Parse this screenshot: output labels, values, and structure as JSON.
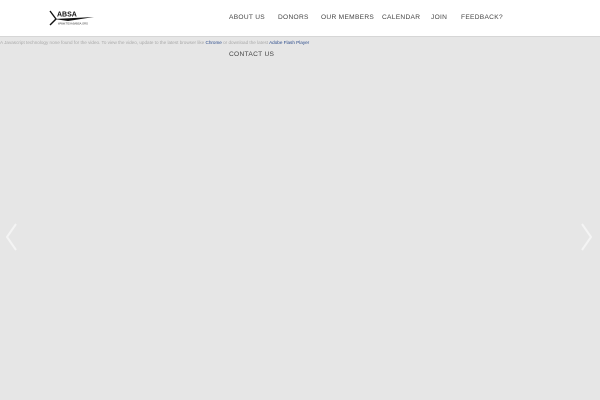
{
  "header": {
    "logo": {
      "text": "ABSA",
      "subtext": "WWW.TEXASABSA.ORG"
    },
    "nav": [
      {
        "label": "ABOUT US"
      },
      {
        "label": "DONORS"
      },
      {
        "label": "OUR MEMBERS"
      },
      {
        "label": "CALENDAR"
      },
      {
        "label": "JOIN"
      },
      {
        "label": "FEEDBACK?"
      },
      {
        "label": "CONTACT US"
      }
    ]
  },
  "notice": {
    "text_before": "A Javascript technology none found for the video. To view the video, update to the latest browser like",
    "chrome_link": "Chrome",
    "text_middle": "or download the latest",
    "flash_link": "Adobe Flash Player"
  },
  "slider": {
    "prev_icon": "chevron-left-icon",
    "next_icon": "chevron-right-icon"
  },
  "colors": {
    "background": "#e6e6e6",
    "header": "#ffffff",
    "link": "#2a4a8a"
  }
}
